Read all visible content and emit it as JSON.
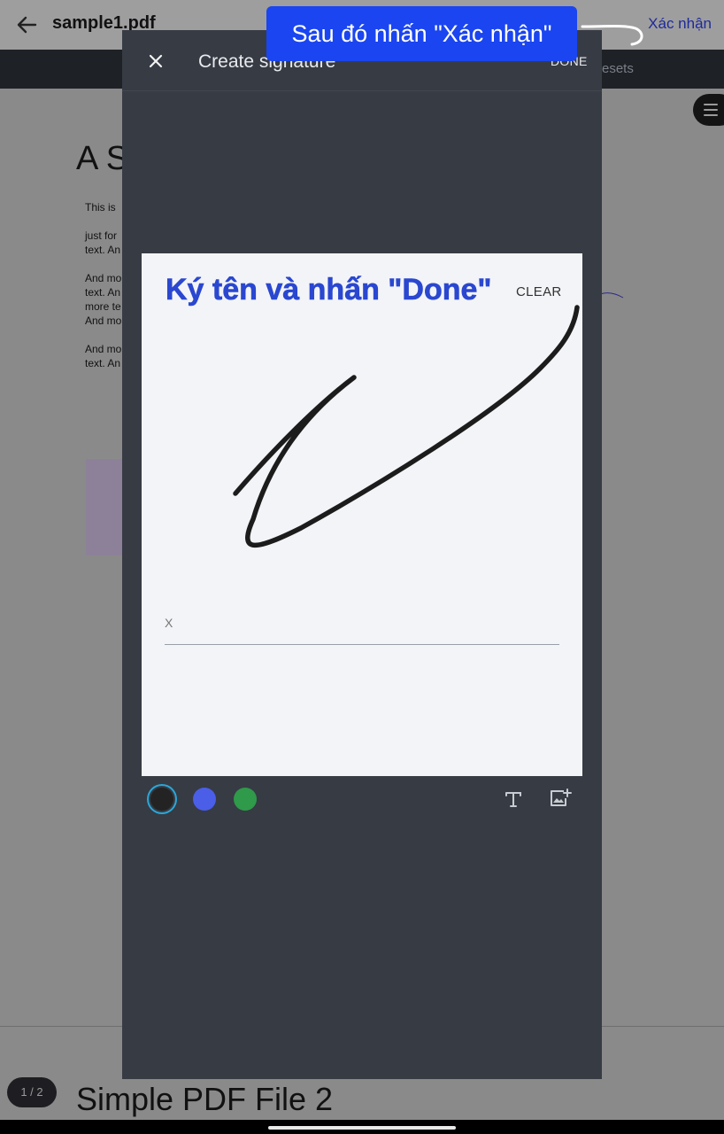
{
  "app": {
    "file_title": "sample1.pdf",
    "confirm_label": "Xác nhận",
    "presets_label": "esets"
  },
  "document": {
    "heading": "A S",
    "lines": [
      "This is",
      "just for",
      "text. An",
      "And mo",
      "text. An",
      "more te",
      "And mo",
      "And mo",
      "text. An"
    ],
    "page_indicator": "1 / 2",
    "page2_title": "Simple PDF File 2"
  },
  "dialog": {
    "title": "Create signature",
    "done_label": "DONE",
    "instruction": "Ký tên và nhấn \"Done\"",
    "clear_label": "CLEAR",
    "sign_marker": "X",
    "colors": [
      "#232323",
      "#4a5ee8",
      "#2f9a4a"
    ],
    "selected_color": "#232323",
    "tools": [
      "text-icon",
      "image-add-icon"
    ]
  },
  "callout": {
    "text": "Sau đó nhấn \"Xác nhận\""
  }
}
